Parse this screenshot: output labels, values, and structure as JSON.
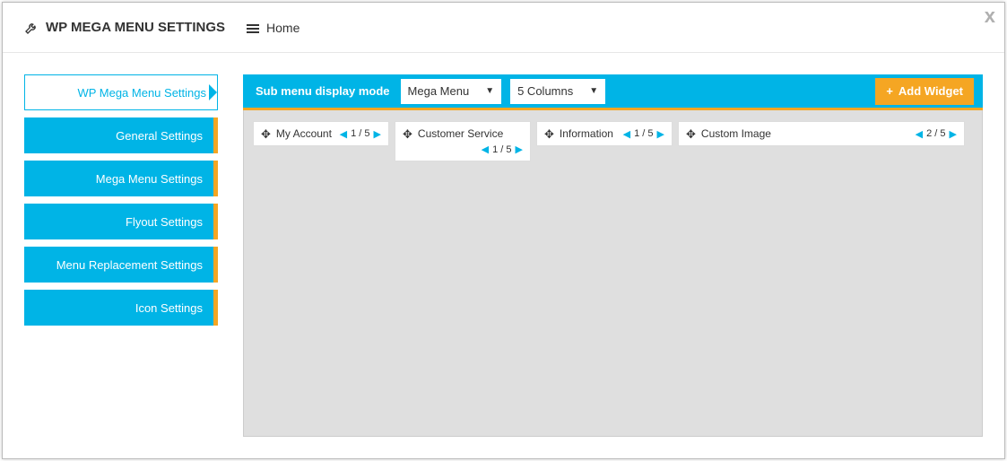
{
  "close_label": "x",
  "header": {
    "title": "WP MEGA MENU SETTINGS",
    "home": "Home"
  },
  "sidebar": {
    "tabs": [
      {
        "label": "WP Mega Menu Settings",
        "active": true
      },
      {
        "label": "General Settings",
        "active": false
      },
      {
        "label": "Mega Menu Settings",
        "active": false
      },
      {
        "label": "Flyout Settings",
        "active": false
      },
      {
        "label": "Menu Replacement Settings",
        "active": false
      },
      {
        "label": "Icon Settings",
        "active": false
      }
    ]
  },
  "topbar": {
    "label": "Sub menu display mode",
    "select_mode": "Mega Menu",
    "select_columns": "5 Columns",
    "add_widget": "Add Widget"
  },
  "widgets": [
    {
      "label": "My Account",
      "pager": "1 / 5",
      "wide": false,
      "pager_below": false
    },
    {
      "label": "Customer Service",
      "pager": "1 / 5",
      "wide": false,
      "pager_below": true
    },
    {
      "label": "Information",
      "pager": "1 / 5",
      "wide": false,
      "pager_below": false
    },
    {
      "label": "Custom Image",
      "pager": "2 / 5",
      "wide": true,
      "pager_below": false
    }
  ]
}
